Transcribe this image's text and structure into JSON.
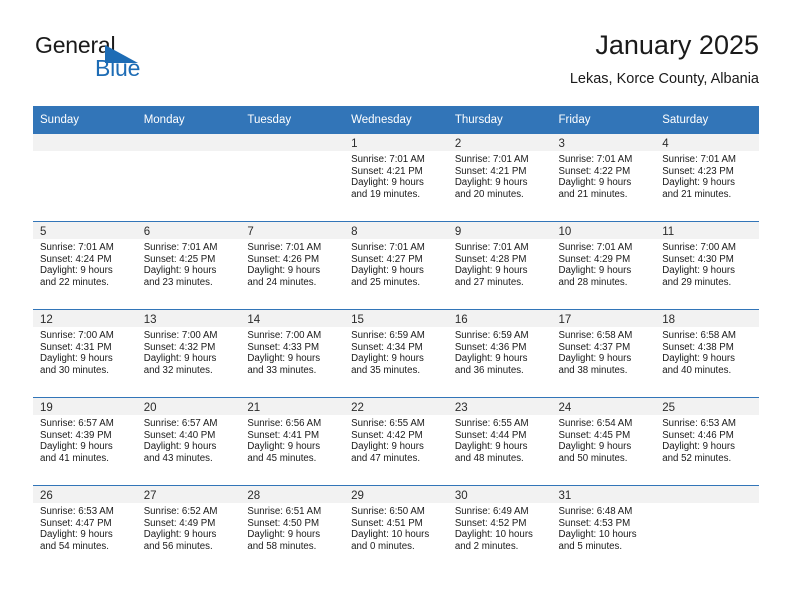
{
  "logo": {
    "general": "General",
    "blue": "Blue",
    "triangle_color": "#1d6cb5"
  },
  "header": {
    "title": "January 2025",
    "subtitle": "Lekas, Korce County, Albania"
  },
  "theme": {
    "header_bg": "#3275b8",
    "daynum_bg": "#f2f2f2",
    "text": "#1a1a1a"
  },
  "weekdays": [
    "Sunday",
    "Monday",
    "Tuesday",
    "Wednesday",
    "Thursday",
    "Friday",
    "Saturday"
  ],
  "weeks": [
    [
      {
        "empty": true
      },
      {
        "empty": true
      },
      {
        "empty": true
      },
      {
        "day": "1",
        "sunrise": "Sunrise: 7:01 AM",
        "sunset": "Sunset: 4:21 PM",
        "daylight1": "Daylight: 9 hours",
        "daylight2": "and 19 minutes."
      },
      {
        "day": "2",
        "sunrise": "Sunrise: 7:01 AM",
        "sunset": "Sunset: 4:21 PM",
        "daylight1": "Daylight: 9 hours",
        "daylight2": "and 20 minutes."
      },
      {
        "day": "3",
        "sunrise": "Sunrise: 7:01 AM",
        "sunset": "Sunset: 4:22 PM",
        "daylight1": "Daylight: 9 hours",
        "daylight2": "and 21 minutes."
      },
      {
        "day": "4",
        "sunrise": "Sunrise: 7:01 AM",
        "sunset": "Sunset: 4:23 PM",
        "daylight1": "Daylight: 9 hours",
        "daylight2": "and 21 minutes."
      }
    ],
    [
      {
        "day": "5",
        "sunrise": "Sunrise: 7:01 AM",
        "sunset": "Sunset: 4:24 PM",
        "daylight1": "Daylight: 9 hours",
        "daylight2": "and 22 minutes."
      },
      {
        "day": "6",
        "sunrise": "Sunrise: 7:01 AM",
        "sunset": "Sunset: 4:25 PM",
        "daylight1": "Daylight: 9 hours",
        "daylight2": "and 23 minutes."
      },
      {
        "day": "7",
        "sunrise": "Sunrise: 7:01 AM",
        "sunset": "Sunset: 4:26 PM",
        "daylight1": "Daylight: 9 hours",
        "daylight2": "and 24 minutes."
      },
      {
        "day": "8",
        "sunrise": "Sunrise: 7:01 AM",
        "sunset": "Sunset: 4:27 PM",
        "daylight1": "Daylight: 9 hours",
        "daylight2": "and 25 minutes."
      },
      {
        "day": "9",
        "sunrise": "Sunrise: 7:01 AM",
        "sunset": "Sunset: 4:28 PM",
        "daylight1": "Daylight: 9 hours",
        "daylight2": "and 27 minutes."
      },
      {
        "day": "10",
        "sunrise": "Sunrise: 7:01 AM",
        "sunset": "Sunset: 4:29 PM",
        "daylight1": "Daylight: 9 hours",
        "daylight2": "and 28 minutes."
      },
      {
        "day": "11",
        "sunrise": "Sunrise: 7:00 AM",
        "sunset": "Sunset: 4:30 PM",
        "daylight1": "Daylight: 9 hours",
        "daylight2": "and 29 minutes."
      }
    ],
    [
      {
        "day": "12",
        "sunrise": "Sunrise: 7:00 AM",
        "sunset": "Sunset: 4:31 PM",
        "daylight1": "Daylight: 9 hours",
        "daylight2": "and 30 minutes."
      },
      {
        "day": "13",
        "sunrise": "Sunrise: 7:00 AM",
        "sunset": "Sunset: 4:32 PM",
        "daylight1": "Daylight: 9 hours",
        "daylight2": "and 32 minutes."
      },
      {
        "day": "14",
        "sunrise": "Sunrise: 7:00 AM",
        "sunset": "Sunset: 4:33 PM",
        "daylight1": "Daylight: 9 hours",
        "daylight2": "and 33 minutes."
      },
      {
        "day": "15",
        "sunrise": "Sunrise: 6:59 AM",
        "sunset": "Sunset: 4:34 PM",
        "daylight1": "Daylight: 9 hours",
        "daylight2": "and 35 minutes."
      },
      {
        "day": "16",
        "sunrise": "Sunrise: 6:59 AM",
        "sunset": "Sunset: 4:36 PM",
        "daylight1": "Daylight: 9 hours",
        "daylight2": "and 36 minutes."
      },
      {
        "day": "17",
        "sunrise": "Sunrise: 6:58 AM",
        "sunset": "Sunset: 4:37 PM",
        "daylight1": "Daylight: 9 hours",
        "daylight2": "and 38 minutes."
      },
      {
        "day": "18",
        "sunrise": "Sunrise: 6:58 AM",
        "sunset": "Sunset: 4:38 PM",
        "daylight1": "Daylight: 9 hours",
        "daylight2": "and 40 minutes."
      }
    ],
    [
      {
        "day": "19",
        "sunrise": "Sunrise: 6:57 AM",
        "sunset": "Sunset: 4:39 PM",
        "daylight1": "Daylight: 9 hours",
        "daylight2": "and 41 minutes."
      },
      {
        "day": "20",
        "sunrise": "Sunrise: 6:57 AM",
        "sunset": "Sunset: 4:40 PM",
        "daylight1": "Daylight: 9 hours",
        "daylight2": "and 43 minutes."
      },
      {
        "day": "21",
        "sunrise": "Sunrise: 6:56 AM",
        "sunset": "Sunset: 4:41 PM",
        "daylight1": "Daylight: 9 hours",
        "daylight2": "and 45 minutes."
      },
      {
        "day": "22",
        "sunrise": "Sunrise: 6:55 AM",
        "sunset": "Sunset: 4:42 PM",
        "daylight1": "Daylight: 9 hours",
        "daylight2": "and 47 minutes."
      },
      {
        "day": "23",
        "sunrise": "Sunrise: 6:55 AM",
        "sunset": "Sunset: 4:44 PM",
        "daylight1": "Daylight: 9 hours",
        "daylight2": "and 48 minutes."
      },
      {
        "day": "24",
        "sunrise": "Sunrise: 6:54 AM",
        "sunset": "Sunset: 4:45 PM",
        "daylight1": "Daylight: 9 hours",
        "daylight2": "and 50 minutes."
      },
      {
        "day": "25",
        "sunrise": "Sunrise: 6:53 AM",
        "sunset": "Sunset: 4:46 PM",
        "daylight1": "Daylight: 9 hours",
        "daylight2": "and 52 minutes."
      }
    ],
    [
      {
        "day": "26",
        "sunrise": "Sunrise: 6:53 AM",
        "sunset": "Sunset: 4:47 PM",
        "daylight1": "Daylight: 9 hours",
        "daylight2": "and 54 minutes."
      },
      {
        "day": "27",
        "sunrise": "Sunrise: 6:52 AM",
        "sunset": "Sunset: 4:49 PM",
        "daylight1": "Daylight: 9 hours",
        "daylight2": "and 56 minutes."
      },
      {
        "day": "28",
        "sunrise": "Sunrise: 6:51 AM",
        "sunset": "Sunset: 4:50 PM",
        "daylight1": "Daylight: 9 hours",
        "daylight2": "and 58 minutes."
      },
      {
        "day": "29",
        "sunrise": "Sunrise: 6:50 AM",
        "sunset": "Sunset: 4:51 PM",
        "daylight1": "Daylight: 10 hours",
        "daylight2": "and 0 minutes."
      },
      {
        "day": "30",
        "sunrise": "Sunrise: 6:49 AM",
        "sunset": "Sunset: 4:52 PM",
        "daylight1": "Daylight: 10 hours",
        "daylight2": "and 2 minutes."
      },
      {
        "day": "31",
        "sunrise": "Sunrise: 6:48 AM",
        "sunset": "Sunset: 4:53 PM",
        "daylight1": "Daylight: 10 hours",
        "daylight2": "and 5 minutes."
      },
      {
        "empty": true
      }
    ]
  ]
}
